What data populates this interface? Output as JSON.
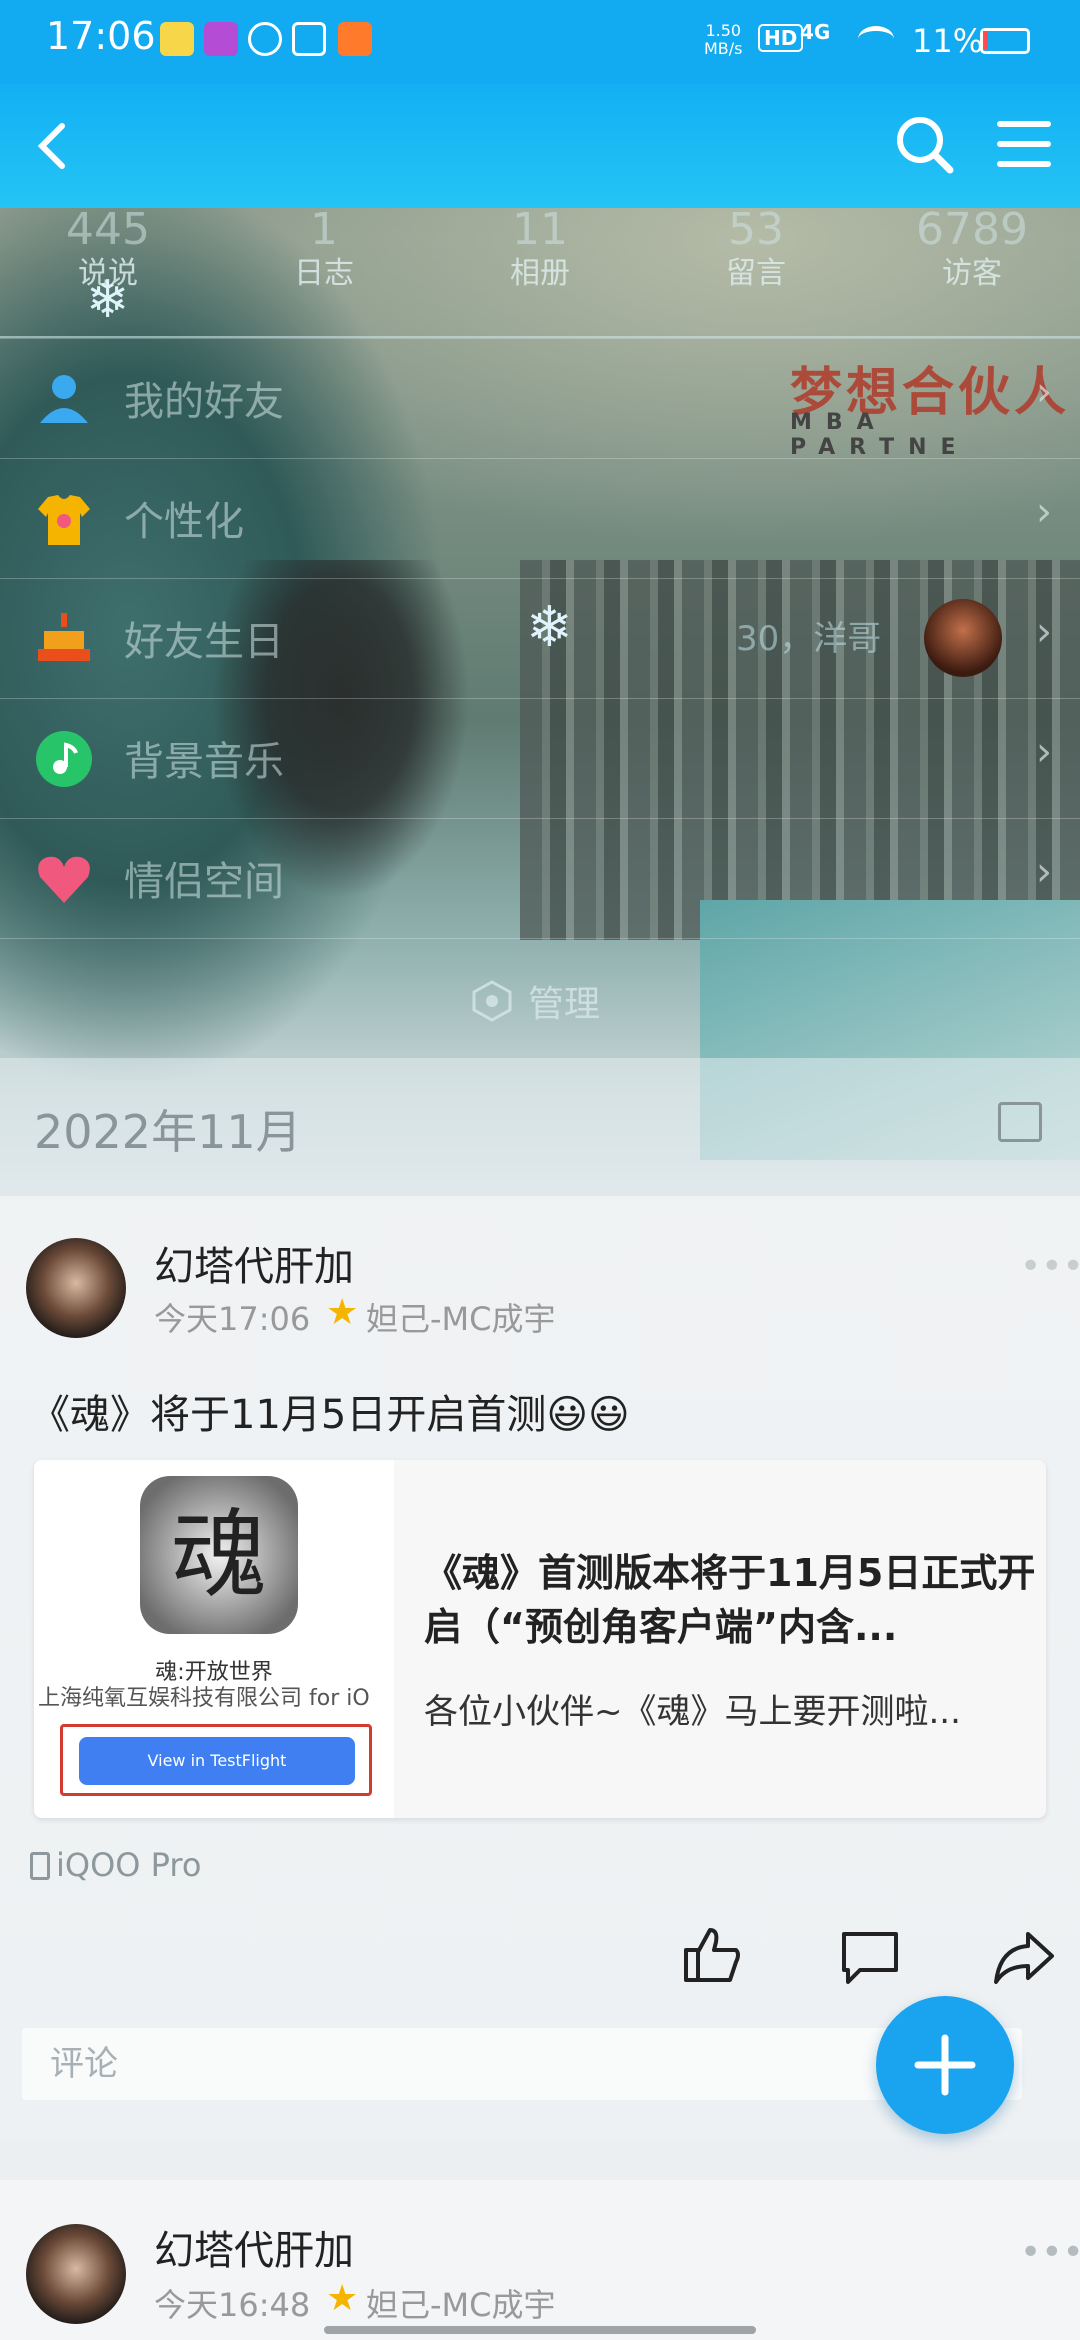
{
  "status_bar": {
    "time": "17:06",
    "speed": "1.50",
    "speed_unit": "MB/s",
    "hd": "HD",
    "network": "4G",
    "battery": "11%"
  },
  "header": {
    "back_icon": "back-icon",
    "search_icon": "search-icon",
    "menu_icon": "menu-icon"
  },
  "stats": [
    {
      "count": "445",
      "label": "说说"
    },
    {
      "count": "1",
      "label": "日志"
    },
    {
      "count": "11",
      "label": "相册"
    },
    {
      "count": "53",
      "label": "留言"
    },
    {
      "count": "6789",
      "label": "访客"
    }
  ],
  "background_brand": {
    "cn": "梦想合伙人",
    "en": "MBA PARTNE"
  },
  "menu": [
    {
      "label": "我的好友",
      "icon": "friends-icon",
      "color": "#3aa9f0"
    },
    {
      "label": "个性化",
      "icon": "tshirt-icon",
      "color": "#f5b400"
    },
    {
      "label": "好友生日",
      "icon": "cake-icon",
      "color": "#f2a01c",
      "extra": "30，洋哥"
    },
    {
      "label": "背景音乐",
      "icon": "music-icon",
      "color": "#27c46a"
    },
    {
      "label": "情侣空间",
      "icon": "heart-icon",
      "color": "#f0587e"
    }
  ],
  "manage_label": "管理",
  "month_header": "2022年11月",
  "posts": [
    {
      "name": "幻塔代肝加",
      "time": "今天17:06",
      "tag": "妲己-MC成宇",
      "text": "《魂》将于11月5日开启首测😃😃",
      "link_card": {
        "app_name": "魂:开放世界",
        "company": "上海纯氧互娱科技有限公司 for iO",
        "button": "View in TestFlight",
        "title": "《魂》首测版本将于11月5日正式开启（“预创角客户端”内含...",
        "desc": "各位小伙伴~《魂》马上要开测啦...",
        "logo_char": "魂"
      },
      "device": "iQOO Pro",
      "comment_placeholder": "评论"
    },
    {
      "name": "幻塔代肝加",
      "time": "今天16:48",
      "tag": "妲己-MC成宇"
    }
  ],
  "fab_icon": "plus-icon",
  "colors": {
    "accent": "#1aa3ef",
    "bar": "#12aaf0"
  }
}
